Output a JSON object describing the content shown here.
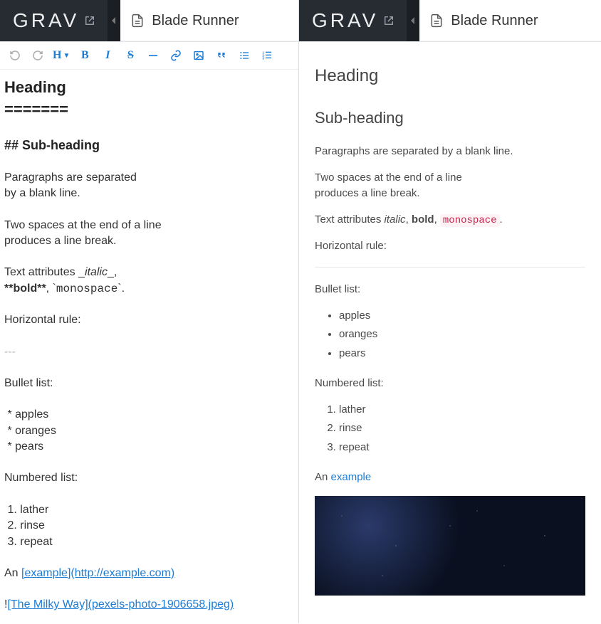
{
  "brand": {
    "name": "GRAV"
  },
  "left": {
    "tab_title": "Blade Runner",
    "toolbar": {
      "heading_label": "H"
    },
    "editor_lines": [
      {
        "t": "Heading",
        "cls": "h1line"
      },
      {
        "t": "=======",
        "cls": "h1line"
      },
      {
        "t": "",
        "cls": ""
      },
      {
        "t": "## Sub-heading",
        "cls": "h2line"
      },
      {
        "t": "",
        "cls": ""
      },
      {
        "t": "Paragraphs are separated",
        "cls": ""
      },
      {
        "t": "by a blank line.",
        "cls": ""
      },
      {
        "t": "",
        "cls": ""
      },
      {
        "t": "Two spaces at the end of a line",
        "cls": ""
      },
      {
        "t": "produces a line break.",
        "cls": ""
      },
      {
        "t": "",
        "cls": ""
      }
    ],
    "attr_line": {
      "prefix": "Text attributes _",
      "italic": "italic",
      "mid1": "_,",
      "mid_break": true,
      "bold_open": "**",
      "bold": "bold",
      "bold_close": "**",
      "sep": ", `",
      "mono": "monospace",
      "suffix": "`."
    },
    "hr_line": "Horizontal rule:",
    "hr_marker": "---",
    "bullet_label": "Bullet list:",
    "bullets": [
      " * apples",
      " * oranges",
      " * pears"
    ],
    "numbered_label": "Numbered list:",
    "numbered": [
      " 1. lather",
      " 2. rinse",
      " 3. repeat"
    ],
    "example_prefix": "An ",
    "example_link": "[example](http://example.com)",
    "image_prefix": "!",
    "image_link": "[The Milky Way](pexels-photo-1906658.jpeg)"
  },
  "right": {
    "tab_title": "Blade Runner",
    "preview": {
      "h1": "Heading",
      "h2": "Sub-heading",
      "p1": "Paragraphs are separated by a blank line.",
      "p2a": "Two spaces at the end of a line",
      "p2b": "produces a line break.",
      "attr_prefix": "Text attributes ",
      "attr_italic": "italic",
      "attr_sep1": ", ",
      "attr_bold": "bold",
      "attr_sep2": ", ",
      "attr_mono": "monospace",
      "attr_suffix": ".",
      "hr_label": "Horizontal rule:",
      "bullet_label": "Bullet list:",
      "bullets": [
        "apples",
        "oranges",
        "pears"
      ],
      "numbered_label": "Numbered list:",
      "numbered": [
        "lather",
        "rinse",
        "repeat"
      ],
      "example_prefix": "An ",
      "example_link": "example"
    }
  }
}
